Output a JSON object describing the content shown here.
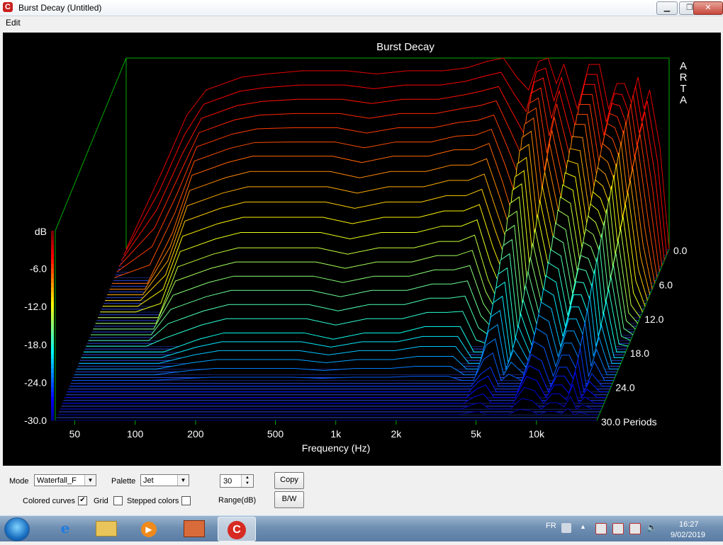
{
  "window": {
    "title": "Burst Decay  (Untitled)",
    "app_icon": "arta-icon",
    "min": "minimize-icon",
    "max": "restore-icon",
    "close": "close-icon"
  },
  "menu": {
    "edit": "Edit"
  },
  "chart_data": {
    "type": "area",
    "title": "Burst Decay",
    "watermark": "ARTA",
    "xlabel": "Frequency (Hz)",
    "x_scale": "log",
    "x_ticks": [
      "50",
      "100",
      "200",
      "500",
      "1k",
      "2k",
      "5k",
      "10k"
    ],
    "zlabel": "dB",
    "z_ticks": [
      "-6.0",
      "-12.0",
      "-18.0",
      "-24.0",
      "-30.0"
    ],
    "z_range": [
      -30,
      0
    ],
    "y_ticks": [
      "0.0",
      "6.0",
      "12.0",
      "18.0",
      "24.0",
      "30.0 Periods"
    ],
    "y_range_periods": [
      0,
      30
    ],
    "palette": "Jet",
    "colors": {
      "background": "#000000",
      "axes": "#00aa00",
      "floor_lines": "#2b45d8",
      "text": "#ffffff"
    },
    "frequencies": [
      40,
      60,
      80,
      100,
      150,
      200,
      300,
      500,
      700,
      1000,
      1500,
      2000,
      2500,
      3000,
      3500,
      4000,
      4500,
      5000,
      5500,
      6000,
      7000,
      8000,
      9000,
      10000,
      11000,
      12000,
      13000,
      14000,
      15000,
      16000,
      18000,
      20000
    ],
    "series": [
      {
        "periods": 0,
        "values": [
          -30,
          -18,
          -9,
          -5,
          -3,
          -2.5,
          -2,
          -2,
          -2.5,
          -2,
          -2,
          -1.5,
          -0.5,
          0,
          -3,
          -5,
          -0.5,
          0,
          -4,
          -1,
          -8,
          -1,
          -1,
          -8,
          -4,
          -4,
          -7,
          -3,
          -8,
          -5,
          -14,
          -30
        ]
      },
      {
        "periods": 6,
        "values": [
          -30,
          -30,
          -22,
          -13,
          -11,
          -10,
          -10,
          -10,
          -11,
          -10,
          -10,
          -9,
          -9,
          -8,
          -14,
          -20,
          -5,
          -4,
          -15,
          -8,
          -18,
          -5,
          -5,
          -15,
          -8,
          -9,
          -12,
          -6,
          -14,
          -10,
          -22,
          -30
        ]
      },
      {
        "periods": 12,
        "values": [
          -30,
          -30,
          -30,
          -22,
          -20,
          -19,
          -19,
          -19,
          -20,
          -19,
          -19,
          -18,
          -18,
          -17,
          -24,
          -28,
          -12,
          -11,
          -25,
          -16,
          -26,
          -11,
          -12,
          -21,
          -14,
          -15,
          -18,
          -11,
          -20,
          -16,
          -28,
          -30
        ]
      },
      {
        "periods": 18,
        "values": [
          -30,
          -30,
          -30,
          -30,
          -28,
          -27,
          -27,
          -27,
          -28,
          -27,
          -27,
          -26,
          -26,
          -26,
          -30,
          -30,
          -20,
          -19,
          -30,
          -24,
          -30,
          -18,
          -19,
          -26,
          -21,
          -21,
          -24,
          -17,
          -26,
          -22,
          -30,
          -30
        ]
      },
      {
        "periods": 24,
        "values": [
          -30,
          -30,
          -30,
          -30,
          -30,
          -30,
          -30,
          -30,
          -30,
          -30,
          -30,
          -30,
          -30,
          -30,
          -30,
          -30,
          -28,
          -27,
          -30,
          -30,
          -30,
          -25,
          -26,
          -30,
          -27,
          -27,
          -29,
          -24,
          -30,
          -28,
          -30,
          -30
        ]
      },
      {
        "periods": 30,
        "values": [
          -30,
          -30,
          -30,
          -30,
          -30,
          -30,
          -30,
          -30,
          -30,
          -30,
          -30,
          -30,
          -30,
          -30,
          -30,
          -30,
          -30,
          -30,
          -30,
          -30,
          -30,
          -30,
          -30,
          -30,
          -30,
          -30,
          -30,
          -30,
          -30,
          -30,
          -30,
          -30
        ]
      }
    ]
  },
  "controls": {
    "mode_label": "Mode",
    "mode_value": "Waterfall_F",
    "palette_label": "Palette",
    "palette_value": "Jet",
    "range_value": "30",
    "range_label": "Range(dB)",
    "copy_label": "Copy",
    "bw_label": "B/W",
    "colored_curves_label": "Colored curves",
    "colored_curves_checked": true,
    "grid_label": "Grid",
    "grid_checked": false,
    "stepped_colors_label": "Stepped colors",
    "stepped_colors_checked": false
  },
  "taskbar": {
    "apps": [
      "ie-icon",
      "explorer-icon",
      "media-player-icon",
      "capture-icon",
      "arta-icon"
    ],
    "lang": "FR",
    "time": "16:27",
    "date": "9/02/2019"
  }
}
